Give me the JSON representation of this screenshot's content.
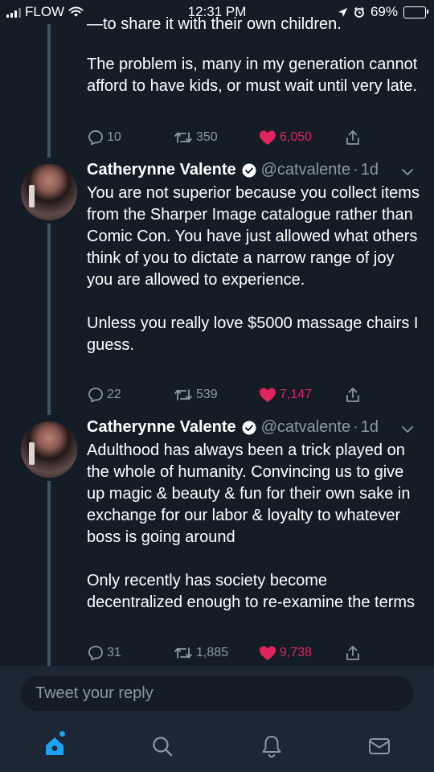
{
  "status_bar": {
    "carrier": "FLOW",
    "time": "12:31 PM",
    "battery_percent": "69%",
    "battery_level": 0.69,
    "icons": [
      "signal-icon",
      "wifi-icon",
      "location-icon",
      "alarm-icon",
      "battery-icon"
    ]
  },
  "prev_tweet": {
    "cut_line": "—to share it with their own children.",
    "paragraphs": [
      "The problem is, many in my generation cannot afford to have kids, or must wait until very late."
    ],
    "replies": "10",
    "retweets": "350",
    "likes": "6,050"
  },
  "tweets": [
    {
      "name": "Catherynne Valente",
      "handle": "@catvalente",
      "dot": "·",
      "time": "1d",
      "paragraphs": [
        "You are not superior because you collect items from the Sharper Image catalogue rather than Comic Con. You have just allowed what others think of you to dictate a narrow range of joy you are allowed to experience.",
        "Unless you really love $5000 massage chairs I guess."
      ],
      "replies": "22",
      "retweets": "539",
      "likes": "7,147"
    },
    {
      "name": "Catherynne Valente",
      "handle": "@catvalente",
      "dot": "·",
      "time": "1d",
      "paragraphs": [
        "Adulthood has always been a trick played on the whole of humanity. Convincing us to give up magic & beauty & fun for their own sake in exchange for our labor & loyalty to whatever boss is going around",
        "Only recently has society become decentralized enough to re-examine the terms"
      ],
      "replies": "31",
      "retweets": "1,885",
      "likes": "9,738"
    }
  ],
  "reply": {
    "placeholder": "Tweet your reply"
  },
  "nav": {
    "icons": [
      "home-icon",
      "search-icon",
      "notifications-icon",
      "messages-icon"
    ]
  },
  "colors": {
    "background": "#141d26",
    "muted": "#8899a6",
    "like": "#e0245e",
    "accent": "#1da1f2",
    "thread_line": "#3d5466"
  }
}
